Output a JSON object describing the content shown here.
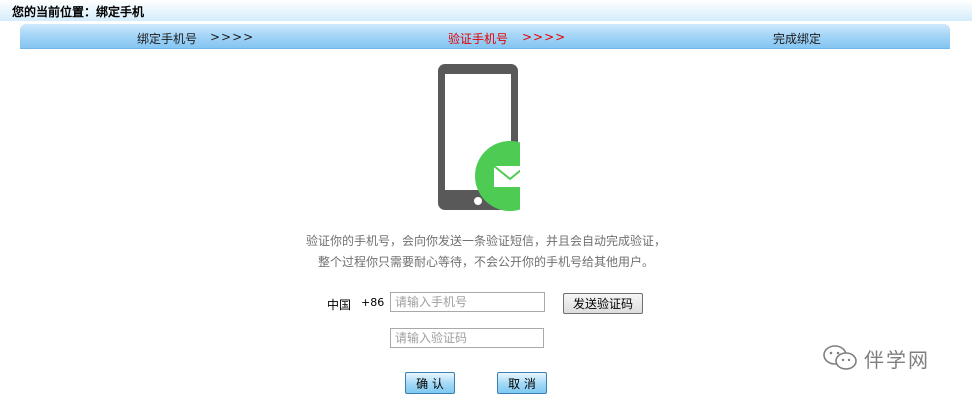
{
  "breadcrumb": {
    "text": "您的当前位置：绑定手机"
  },
  "steps": [
    {
      "label": "绑定手机号",
      "arrows": ">>>>"
    },
    {
      "label": "验证手机号",
      "arrows": ">>>>"
    },
    {
      "label": "完成绑定"
    }
  ],
  "active_step": "验证手机号",
  "colors": {
    "active": "#e60000",
    "envelope_badge": "#4ecb52",
    "phone_body": "#595959"
  },
  "icons": {
    "phone": "phone-icon",
    "envelope": "envelope-icon",
    "watermark": "wechat-icon"
  },
  "hint": {
    "line1": "验证你的手机号，会向你发送一条验证短信，并且会自动完成验证，",
    "line2": "整个过程你只需要耐心等待，不会公开你的手机号给其他用户。"
  },
  "form": {
    "country_label": "中国",
    "country_code": "+86",
    "phone_placeholder": "请输入手机号",
    "phone_value": "",
    "send_button": "发送验证码",
    "code_placeholder": "请输入验证码",
    "code_value": ""
  },
  "actions": {
    "confirm": "确 认",
    "cancel": "取 消"
  },
  "watermark": {
    "text": "伴学网"
  }
}
